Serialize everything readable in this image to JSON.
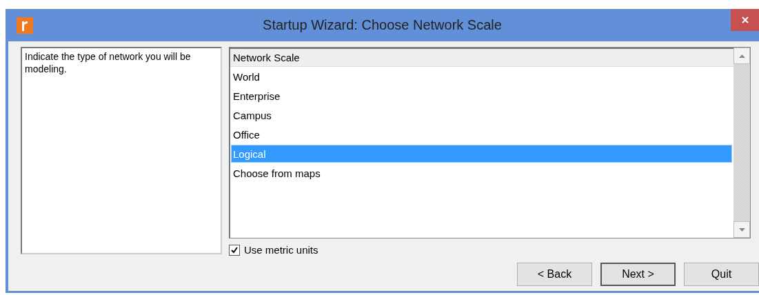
{
  "window": {
    "title": "Startup Wizard: Choose Network Scale"
  },
  "description": "Indicate the type of network you will be modeling.",
  "list": {
    "header": "Network Scale",
    "items": [
      {
        "label": "World",
        "selected": false
      },
      {
        "label": "Enterprise",
        "selected": false
      },
      {
        "label": "Campus",
        "selected": false
      },
      {
        "label": "Office",
        "selected": false
      },
      {
        "label": "Logical",
        "selected": true
      },
      {
        "label": "Choose from maps",
        "selected": false
      }
    ]
  },
  "metric_units": {
    "label": "Use metric units",
    "checked": true
  },
  "buttons": [
    {
      "label": "< Back",
      "default": false
    },
    {
      "label": "Next >",
      "default": true
    },
    {
      "label": "Quit",
      "default": false
    }
  ]
}
